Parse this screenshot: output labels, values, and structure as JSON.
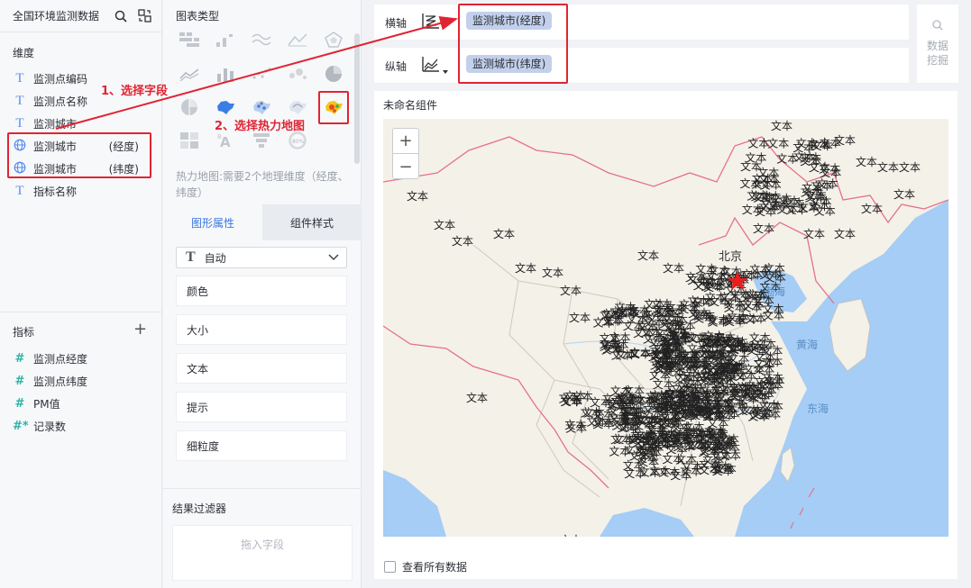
{
  "left_panel": {
    "title": "全国环境监测数据",
    "dimension_label": "维度",
    "dimensions": [
      {
        "label": "监测点编码",
        "icon": "text-type-icon"
      },
      {
        "label": "监测点名称",
        "icon": "text-type-icon"
      },
      {
        "label": "监测城市",
        "icon": "text-type-icon"
      },
      {
        "label": "监测城市",
        "extra": "(经度)",
        "icon": "globe-icon"
      },
      {
        "label": "监测城市",
        "extra": "(纬度)",
        "icon": "globe-icon"
      },
      {
        "label": "指标名称",
        "icon": "text-type-icon"
      }
    ],
    "metric_label": "指标",
    "metrics": [
      {
        "label": "监测点经度",
        "icon": "#"
      },
      {
        "label": "监测点纬度",
        "icon": "#"
      },
      {
        "label": "PM值",
        "icon": "#"
      },
      {
        "label": "记录数",
        "icon": "#*"
      }
    ]
  },
  "mid_panel": {
    "chart_type_title": "图表类型",
    "hint": "热力地图:需要2个地理维度（经度、纬度）",
    "tabs": {
      "graphic": "图形属性",
      "style": "组件样式"
    },
    "auto_select": "自动",
    "properties": [
      "颜色",
      "大小",
      "文本",
      "提示",
      "细粒度"
    ],
    "filter_title": "结果过滤器",
    "drop_hint": "拖入字段"
  },
  "axes": {
    "x_label": "横轴",
    "x_field": "监测城市(经度)",
    "y_label": "纵轴",
    "y_field": "监测城市(纬度)"
  },
  "mining_label_1": "数据",
  "mining_label_2": "挖掘",
  "widget": {
    "title": "未命名组件",
    "view_all": "查看所有数据",
    "zoom_in": "+",
    "zoom_out": "−"
  },
  "map": {
    "point_label": "文本",
    "labels": {
      "beijing": "北京",
      "bohai": "渤海",
      "huanghai": "黄海",
      "donghai": "东海"
    }
  },
  "annotations": {
    "step1": "1、选择字段",
    "step2": "2、选择热力地图"
  },
  "colors": {
    "accent": "#3976e0",
    "annotation": "#e02433",
    "pill": "#c3d0ec",
    "water": "#a5cdf5"
  }
}
